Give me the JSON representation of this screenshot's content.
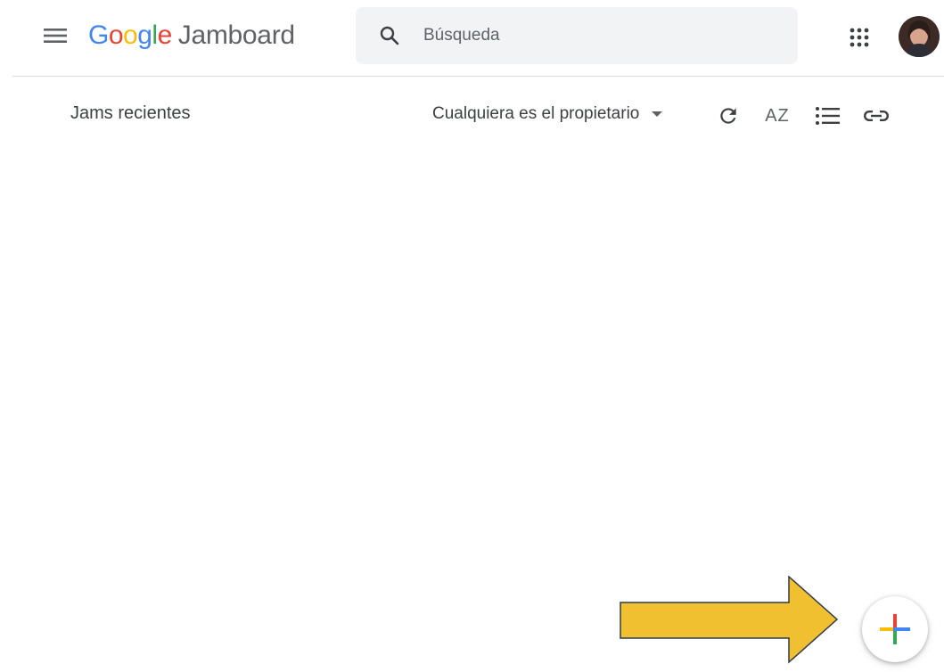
{
  "header": {
    "logo": {
      "part1": "Google",
      "part2": "Jamboard"
    },
    "search": {
      "placeholder": "Búsqueda"
    },
    "icons": {
      "menu": "menu-icon",
      "search": "search-icon",
      "apps": "apps-grid-icon",
      "avatar": "user-avatar"
    }
  },
  "toolbar": {
    "section_title": "Jams recientes",
    "owner_filter": "Cualquiera es el propietario",
    "sort_label": "AZ",
    "icons": {
      "refresh": "refresh-icon",
      "sort": "sort-az-icon",
      "list": "list-view-icon",
      "link": "link-icon"
    }
  },
  "fab": {
    "icon": "add-plus-icon"
  },
  "overlay": {
    "arrow_color": "#f0c030",
    "arrow_border": "#2f3a4a"
  },
  "colors": {
    "google_blue": "#4285f4",
    "google_red": "#ea4335",
    "google_yellow": "#fbbc05",
    "google_green": "#34a853"
  }
}
